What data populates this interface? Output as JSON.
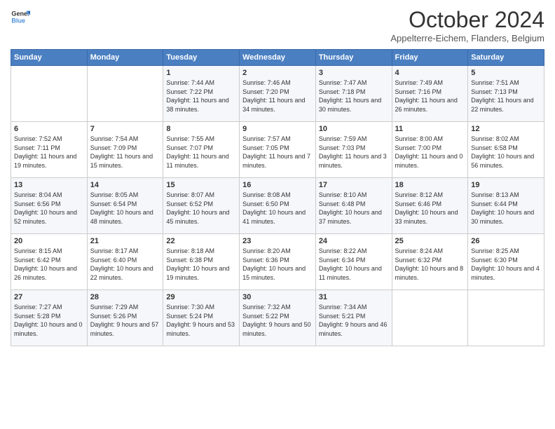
{
  "header": {
    "logo_line1": "General",
    "logo_line2": "Blue",
    "month_title": "October 2024",
    "subtitle": "Appelterre-Eichem, Flanders, Belgium"
  },
  "weekdays": [
    "Sunday",
    "Monday",
    "Tuesday",
    "Wednesday",
    "Thursday",
    "Friday",
    "Saturday"
  ],
  "weeks": [
    [
      {
        "day": "",
        "info": ""
      },
      {
        "day": "",
        "info": ""
      },
      {
        "day": "1",
        "info": "Sunrise: 7:44 AM\nSunset: 7:22 PM\nDaylight: 11 hours and 38 minutes."
      },
      {
        "day": "2",
        "info": "Sunrise: 7:46 AM\nSunset: 7:20 PM\nDaylight: 11 hours and 34 minutes."
      },
      {
        "day": "3",
        "info": "Sunrise: 7:47 AM\nSunset: 7:18 PM\nDaylight: 11 hours and 30 minutes."
      },
      {
        "day": "4",
        "info": "Sunrise: 7:49 AM\nSunset: 7:16 PM\nDaylight: 11 hours and 26 minutes."
      },
      {
        "day": "5",
        "info": "Sunrise: 7:51 AM\nSunset: 7:13 PM\nDaylight: 11 hours and 22 minutes."
      }
    ],
    [
      {
        "day": "6",
        "info": "Sunrise: 7:52 AM\nSunset: 7:11 PM\nDaylight: 11 hours and 19 minutes."
      },
      {
        "day": "7",
        "info": "Sunrise: 7:54 AM\nSunset: 7:09 PM\nDaylight: 11 hours and 15 minutes."
      },
      {
        "day": "8",
        "info": "Sunrise: 7:55 AM\nSunset: 7:07 PM\nDaylight: 11 hours and 11 minutes."
      },
      {
        "day": "9",
        "info": "Sunrise: 7:57 AM\nSunset: 7:05 PM\nDaylight: 11 hours and 7 minutes."
      },
      {
        "day": "10",
        "info": "Sunrise: 7:59 AM\nSunset: 7:03 PM\nDaylight: 11 hours and 3 minutes."
      },
      {
        "day": "11",
        "info": "Sunrise: 8:00 AM\nSunset: 7:00 PM\nDaylight: 11 hours and 0 minutes."
      },
      {
        "day": "12",
        "info": "Sunrise: 8:02 AM\nSunset: 6:58 PM\nDaylight: 10 hours and 56 minutes."
      }
    ],
    [
      {
        "day": "13",
        "info": "Sunrise: 8:04 AM\nSunset: 6:56 PM\nDaylight: 10 hours and 52 minutes."
      },
      {
        "day": "14",
        "info": "Sunrise: 8:05 AM\nSunset: 6:54 PM\nDaylight: 10 hours and 48 minutes."
      },
      {
        "day": "15",
        "info": "Sunrise: 8:07 AM\nSunset: 6:52 PM\nDaylight: 10 hours and 45 minutes."
      },
      {
        "day": "16",
        "info": "Sunrise: 8:08 AM\nSunset: 6:50 PM\nDaylight: 10 hours and 41 minutes."
      },
      {
        "day": "17",
        "info": "Sunrise: 8:10 AM\nSunset: 6:48 PM\nDaylight: 10 hours and 37 minutes."
      },
      {
        "day": "18",
        "info": "Sunrise: 8:12 AM\nSunset: 6:46 PM\nDaylight: 10 hours and 33 minutes."
      },
      {
        "day": "19",
        "info": "Sunrise: 8:13 AM\nSunset: 6:44 PM\nDaylight: 10 hours and 30 minutes."
      }
    ],
    [
      {
        "day": "20",
        "info": "Sunrise: 8:15 AM\nSunset: 6:42 PM\nDaylight: 10 hours and 26 minutes."
      },
      {
        "day": "21",
        "info": "Sunrise: 8:17 AM\nSunset: 6:40 PM\nDaylight: 10 hours and 22 minutes."
      },
      {
        "day": "22",
        "info": "Sunrise: 8:18 AM\nSunset: 6:38 PM\nDaylight: 10 hours and 19 minutes."
      },
      {
        "day": "23",
        "info": "Sunrise: 8:20 AM\nSunset: 6:36 PM\nDaylight: 10 hours and 15 minutes."
      },
      {
        "day": "24",
        "info": "Sunrise: 8:22 AM\nSunset: 6:34 PM\nDaylight: 10 hours and 11 minutes."
      },
      {
        "day": "25",
        "info": "Sunrise: 8:24 AM\nSunset: 6:32 PM\nDaylight: 10 hours and 8 minutes."
      },
      {
        "day": "26",
        "info": "Sunrise: 8:25 AM\nSunset: 6:30 PM\nDaylight: 10 hours and 4 minutes."
      }
    ],
    [
      {
        "day": "27",
        "info": "Sunrise: 7:27 AM\nSunset: 5:28 PM\nDaylight: 10 hours and 0 minutes."
      },
      {
        "day": "28",
        "info": "Sunrise: 7:29 AM\nSunset: 5:26 PM\nDaylight: 9 hours and 57 minutes."
      },
      {
        "day": "29",
        "info": "Sunrise: 7:30 AM\nSunset: 5:24 PM\nDaylight: 9 hours and 53 minutes."
      },
      {
        "day": "30",
        "info": "Sunrise: 7:32 AM\nSunset: 5:22 PM\nDaylight: 9 hours and 50 minutes."
      },
      {
        "day": "31",
        "info": "Sunrise: 7:34 AM\nSunset: 5:21 PM\nDaylight: 9 hours and 46 minutes."
      },
      {
        "day": "",
        "info": ""
      },
      {
        "day": "",
        "info": ""
      }
    ]
  ]
}
